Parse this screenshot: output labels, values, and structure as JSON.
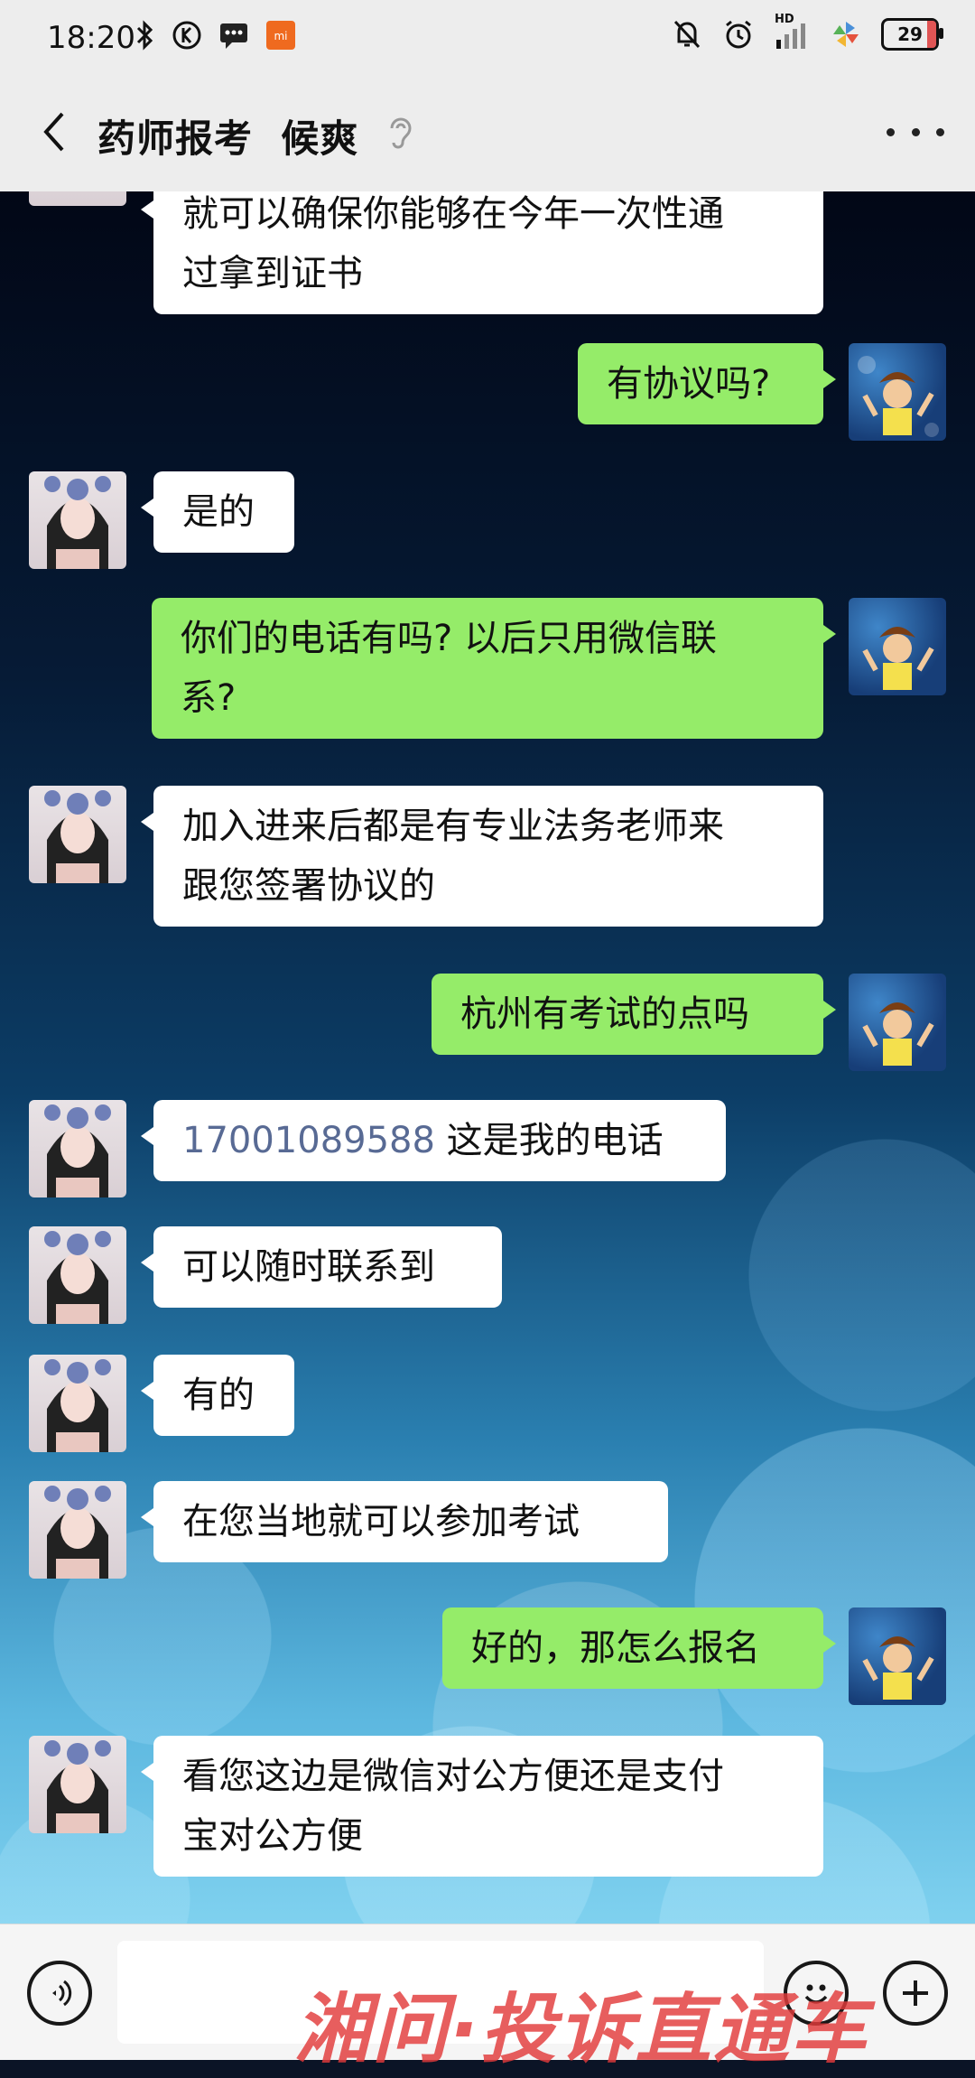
{
  "status_bar": {
    "time": "18:20",
    "left_icons": [
      "bluetooth-icon",
      "k-app-icon",
      "message-icon",
      "mi-app-icon"
    ],
    "right_icons": [
      "mute-bell-icon",
      "alarm-icon",
      "hd-signal-icon",
      "pinwheel-icon"
    ],
    "network_label": "HD",
    "battery": "29"
  },
  "header": {
    "title": "药师报考  候爽",
    "back_icon": "chevron-left-icon",
    "mode_icon": "ear-icon",
    "more_icon": "more-dots-icon"
  },
  "messages": [
    {
      "side": "left",
      "text_lines": [
        "就可以确保你能够在今年一次性通",
        "过拿到证书"
      ],
      "avatar": "avatar-girl"
    },
    {
      "side": "right",
      "text_lines": [
        "有协议吗?"
      ],
      "avatar": "avatar-boy"
    },
    {
      "side": "left",
      "text_lines": [
        "是的"
      ],
      "avatar": "avatar-girl"
    },
    {
      "side": "right",
      "text_lines": [
        "你们的电话有吗? 以后只用微信联",
        "系?"
      ],
      "avatar": "avatar-boy"
    },
    {
      "side": "left",
      "text_lines": [
        "加入进来后都是有专业法务老师来",
        "跟您签署协议的"
      ],
      "avatar": "avatar-girl"
    },
    {
      "side": "right",
      "text_lines": [
        "杭州有考试的点吗"
      ],
      "avatar": "avatar-boy"
    },
    {
      "side": "left",
      "phone": "17001089588",
      "text_lines": [
        " 这是我的电话"
      ],
      "avatar": "avatar-girl"
    },
    {
      "side": "left",
      "text_lines": [
        "可以随时联系到"
      ],
      "avatar": "avatar-girl"
    },
    {
      "side": "left",
      "text_lines": [
        "有的"
      ],
      "avatar": "avatar-girl"
    },
    {
      "side": "left",
      "text_lines": [
        "在您当地就可以参加考试"
      ],
      "avatar": "avatar-girl"
    },
    {
      "side": "right",
      "text_lines": [
        "好的，那怎么报名"
      ],
      "avatar": "avatar-boy"
    },
    {
      "side": "left",
      "text_lines": [
        "看您这边是微信对公方便还是支付",
        "宝对公方便"
      ],
      "avatar": "avatar-girl"
    }
  ],
  "input_bar": {
    "voice_icon": "voice-icon",
    "emoji_icon": "emoji-icon",
    "plus_icon": "plus-icon",
    "input_value": ""
  },
  "watermark": "湘问·投诉直通车",
  "colors": {
    "header_bg": "#ededed",
    "bubble_left": "#ffffff",
    "bubble_right": "#95ec69",
    "phone_link": "#586a94",
    "watermark": "#e23b3b"
  }
}
